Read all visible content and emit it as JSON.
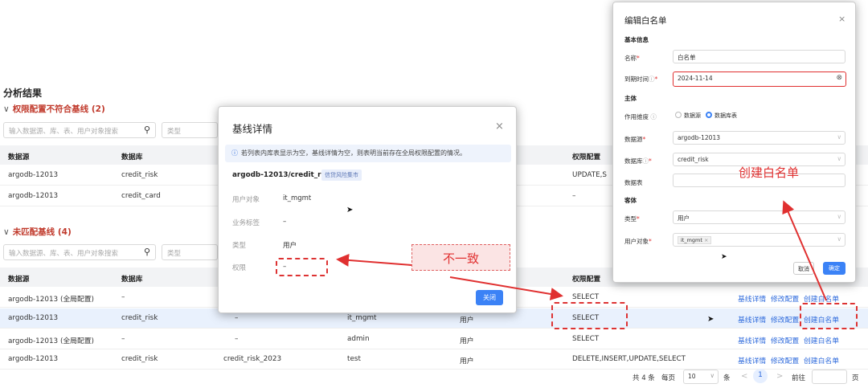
{
  "main": {
    "title": "分析结果",
    "section1": {
      "chev": "∨",
      "label": "权限配置不符合基线 (2)",
      "search_placeholder": "输入数据源、库、表、用户对象搜索",
      "type_placeholder": "类型"
    },
    "section2": {
      "chev": "∨",
      "label": "未匹配基线 (4)",
      "search_placeholder": "输入数据源、库、表、用户对象搜索",
      "type_placeholder": "类型"
    },
    "columns": {
      "datasource": "数据源",
      "database": "数据库",
      "perm": "权限配置"
    },
    "table1": [
      {
        "ds": "argodb-12013",
        "db": "credit_risk",
        "perm": "UPDATE,S"
      },
      {
        "ds": "argodb-12013",
        "db": "credit_card",
        "perm": "–"
      }
    ],
    "table2": [
      {
        "ds": "argodb-12013 (全局配置)",
        "db": "–",
        "table": "",
        "user": "",
        "type": "",
        "perm": "SELECT",
        "a1": "基线详情",
        "a2": "修改配置",
        "a3": "创建白名单"
      },
      {
        "ds": "argodb-12013",
        "db": "credit_risk",
        "table": "–",
        "user": "it_mgmt",
        "type": "用户",
        "perm": "SELECT",
        "a1": "基线详情",
        "a2": "修改配置",
        "a3": "创建白名单"
      },
      {
        "ds": "argodb-12013 (全局配置)",
        "db": "–",
        "table": "–",
        "user": "admin",
        "type": "用户",
        "perm": "SELECT",
        "a1": "基线详情",
        "a2": "修改配置",
        "a3": "创建白名单"
      },
      {
        "ds": "argodb-12013",
        "db": "credit_risk",
        "table": "credit_risk_2023",
        "user": "test",
        "type": "用户",
        "perm": "DELETE,INSERT,UPDATE,SELECT",
        "a1": "基线详情",
        "a2": "修改配置",
        "a3": "创建白名单"
      }
    ],
    "pagination": {
      "total": "共 4 条",
      "per_page_label": "每页",
      "per_page": "10",
      "unit": "条",
      "prev": "<",
      "page": "1",
      "next": ">",
      "goto": "前往",
      "page_suffix": "页"
    }
  },
  "baseline_modal": {
    "title": "基线详情",
    "close": "×",
    "info": "若列表内库表显示为空，基线详情为空，则表明当前存在全局权限配置的情况。",
    "path": "argodb-12013/credit_risk",
    "tag": "信贷风险集市",
    "fields": [
      {
        "label": "用户对象",
        "value": "it_mgmt"
      },
      {
        "label": "业务标签",
        "value": "–"
      },
      {
        "label": "类型",
        "value": "用户"
      },
      {
        "label": "权限",
        "value": "–"
      }
    ],
    "close_button": "关闭"
  },
  "whitelist_modal": {
    "title": "编辑白名单",
    "close": "×",
    "basic_info": "基本信息",
    "name_label": "名称",
    "name_value": "白名单",
    "expire_label": "到期时间",
    "expire_value": "2024-11-14",
    "subject": "主体",
    "scope_label": "作用维度",
    "scope_opt1": "数据源",
    "scope_opt2": "数据库表",
    "datasource_label": "数据源",
    "datasource_value": "argodb-12013",
    "database_label": "数据库",
    "database_value": "credit_risk",
    "table_label": "数据表",
    "object": "客体",
    "type_label": "类型",
    "type_value": "用户",
    "user_label": "用户对象",
    "user_value": "it_mgmt",
    "cancel": "取消",
    "confirm": "确定"
  },
  "annotations": {
    "mismatch": "不一致",
    "create": "创建白名单"
  },
  "colors": {
    "accent": "#3b82f6",
    "alert": "#e03030",
    "link": "#2f6bdc"
  }
}
